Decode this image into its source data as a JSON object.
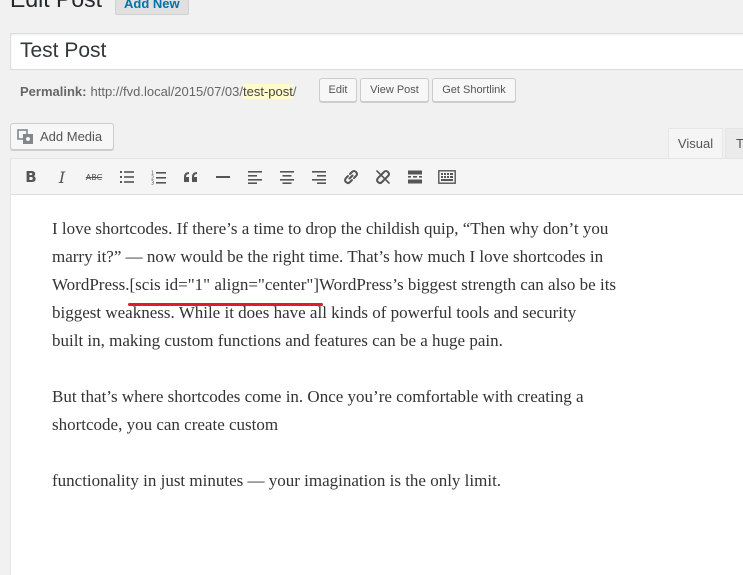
{
  "header": {
    "title": "Edit Post",
    "add_new_label": "Add New"
  },
  "post": {
    "title_value": "Test Post"
  },
  "permalink": {
    "label": "Permalink:",
    "base_url": "http://fvd.local/2015/07/03/",
    "slug": "test-post",
    "trailing": "/",
    "edit_label": "Edit",
    "view_label": "View Post",
    "shortlink_label": "Get Shortlink"
  },
  "media": {
    "add_media_label": "Add Media"
  },
  "editor_tabs": {
    "visual_label": "Visual",
    "text_label": "Text"
  },
  "toolbar": {
    "buttons": [
      {
        "name": "bold",
        "icon": "bold-icon",
        "label": "B"
      },
      {
        "name": "italic",
        "icon": "italic-icon",
        "label": "I"
      },
      {
        "name": "strikethrough",
        "icon": "strikethrough-icon",
        "label": "ABC"
      },
      {
        "name": "bulleted-list",
        "icon": "bulleted-list-icon"
      },
      {
        "name": "numbered-list",
        "icon": "numbered-list-icon"
      },
      {
        "name": "blockquote",
        "icon": "blockquote-icon",
        "label": "“"
      },
      {
        "name": "horizontal-line",
        "icon": "horizontal-line-icon"
      },
      {
        "name": "align-left",
        "icon": "align-left-icon"
      },
      {
        "name": "align-center",
        "icon": "align-center-icon"
      },
      {
        "name": "align-right",
        "icon": "align-right-icon"
      },
      {
        "name": "insert-link",
        "icon": "link-icon"
      },
      {
        "name": "remove-link",
        "icon": "unlink-icon"
      },
      {
        "name": "read-more",
        "icon": "read-more-icon"
      },
      {
        "name": "toolbar-toggle",
        "icon": "keyboard-icon"
      }
    ]
  },
  "content": {
    "p1_line1": "I love shortcodes. If there’s a time to drop the childish quip, “Then why don’t you",
    "p1_line2": "marry it?” — now would be the right time. That’s how much I love shortcodes in",
    "p1_line3_pre": "WordPress.",
    "shortcode": "[scis id=\"1\" align=\"center\"]",
    "p1_line3_post": "WordPress’s biggest strength can also be its",
    "p1_line4": "biggest weakness. While it does have all kinds of powerful tools and security",
    "p1_line5": "built in, making custom functions and features can be a huge pain.",
    "p2_line1": "But that’s where shortcodes come in. Once you’re comfortable with creating a",
    "p2_line2": "shortcode, you can create custom",
    "p3_line1": "functionality in just minutes — your imagination is the only limit."
  },
  "colors": {
    "accent_link": "#0073aa",
    "shortcode_underline": "#e31a2c",
    "slug_highlight": "#fffbcc"
  }
}
